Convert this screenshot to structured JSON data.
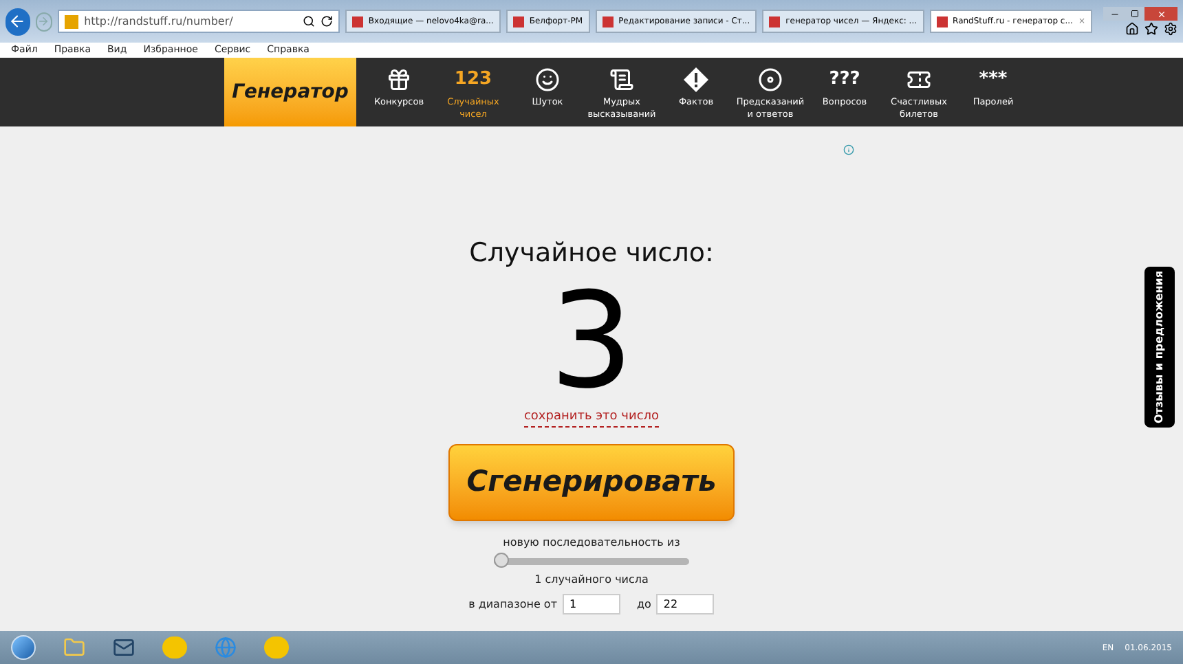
{
  "browser": {
    "address": "http://randstuff.ru/number/",
    "tabs": [
      {
        "label": "Входящие — nelovo4ka@ra...",
        "selected": false
      },
      {
        "label": "Белфорт-РМ",
        "selected": false
      },
      {
        "label": "Редактирование записи - Ст...",
        "selected": false
      },
      {
        "label": "генератор чисел — Яндекс: ...",
        "selected": false
      },
      {
        "label": "RandStuff.ru - генератор с...",
        "selected": true
      }
    ],
    "close_tab": "×",
    "menu": [
      "Файл",
      "Правка",
      "Вид",
      "Избранное",
      "Сервис",
      "Справка"
    ]
  },
  "site": {
    "logo": "Генератор",
    "nav": [
      {
        "label": "Конкурсов",
        "selected": false
      },
      {
        "label": "Случайных чисел",
        "glyph": "123",
        "selected": true
      },
      {
        "label": "Шуток",
        "selected": false
      },
      {
        "label": "Мудрых высказываний",
        "selected": false
      },
      {
        "label": "Фактов",
        "selected": false
      },
      {
        "label": "Предсказаний и ответов",
        "selected": false
      },
      {
        "label": "Вопросов",
        "glyph": "???",
        "selected": false
      },
      {
        "label": "Счастливых билетов",
        "selected": false
      },
      {
        "label": "Паролей",
        "glyph": "***",
        "selected": false
      }
    ],
    "heading": "Случайное число:",
    "number": "3",
    "save_link": "сохранить это число",
    "generate_button": "Сгенерировать",
    "sequence_label": "новую последовательность из",
    "slider": {
      "level": 0
    },
    "count_label": "1 случайного числа",
    "range_label": "в диапазоне от",
    "from": "1",
    "to_label": "до",
    "to": "22",
    "feedback_tab": "Отзывы и предложения"
  },
  "taskbar": {
    "language": "EN",
    "date": "01.06.2015"
  }
}
